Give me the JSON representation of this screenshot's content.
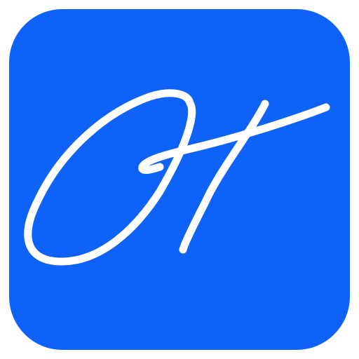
{
  "icon": {
    "name": "OT",
    "background_color": "#0E62F7",
    "glyph_color": "#FFFFFF"
  }
}
